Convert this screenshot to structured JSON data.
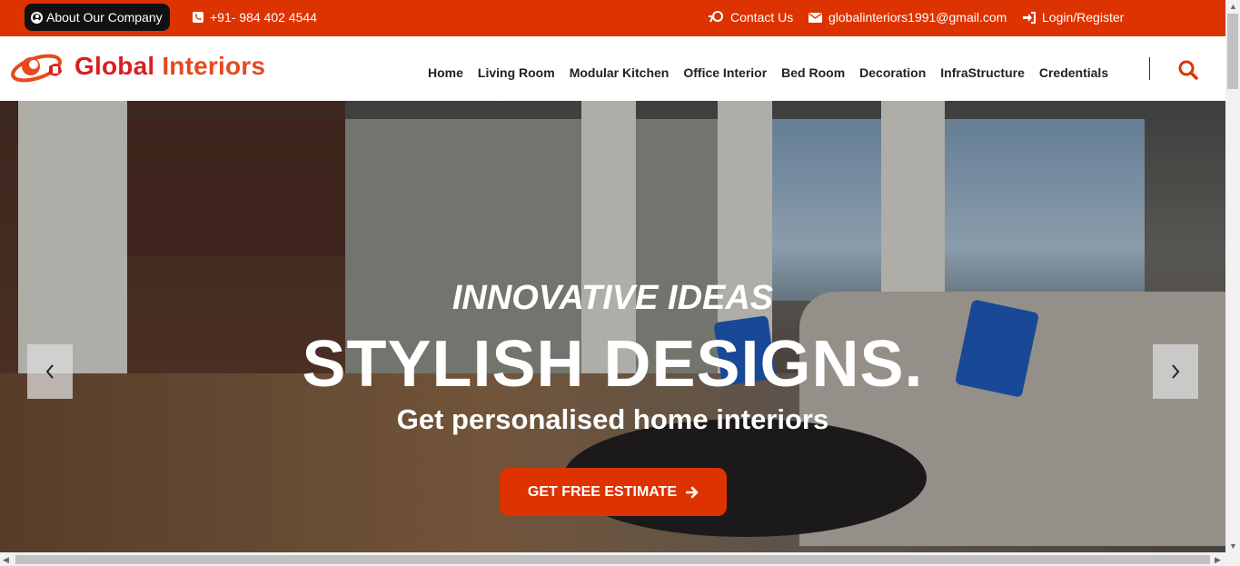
{
  "topbar": {
    "about_label": "About Our Company",
    "phone": "+91- 984 402 4544",
    "contact_label": "Contact Us",
    "email": "globalinteriors1991@gmail.com",
    "login_label": "Login/Register"
  },
  "brand": {
    "name_part1": "Global",
    "name_part2": "Interiors"
  },
  "nav": {
    "items": [
      "Home",
      "Living Room",
      "Modular Kitchen",
      "Office Interior",
      "Bed Room",
      "Decoration",
      "InfraStructure",
      "Credentials"
    ]
  },
  "hero": {
    "line1": "INNOVATIVE IDEAS",
    "line2": "STYLISH DESIGNS.",
    "line3": "Get personalised home interiors",
    "cta_label": "GET FREE ESTIMATE"
  },
  "colors": {
    "accent": "#dd3300",
    "dark": "#111111"
  }
}
